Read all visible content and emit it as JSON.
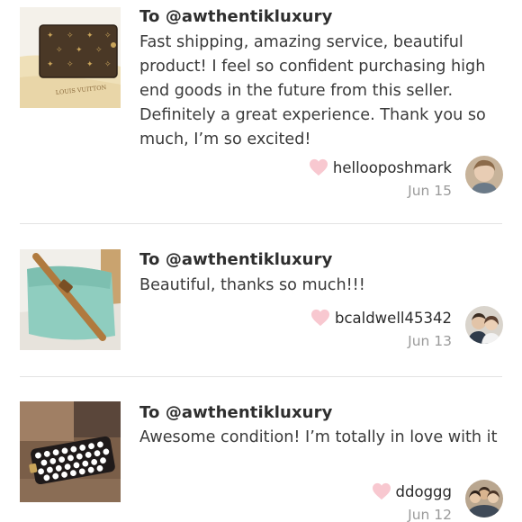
{
  "reviews": [
    {
      "to_line": "To @awthentikluxury",
      "text": "Fast shipping, amazing service, beautiful product! I feel so confident purchasing high end goods in the future from this seller. Definitely a great experience. Thank you so much, I’m so excited!",
      "username": "hellooposhmark",
      "date": "Jun 15",
      "photo_print": "LOUIS VUITTON",
      "heart_color": "#f8c8d0"
    },
    {
      "to_line": "To @awthentikluxury",
      "text": "Beautiful, thanks so much!!!",
      "username": "bcaldwell45342",
      "date": "Jun 13",
      "heart_color": "#f8c8d0"
    },
    {
      "to_line": "To @awthentikluxury",
      "text": "Awesome condition! I’m totally in love with it",
      "username": "ddoggg",
      "date": "Jun 12",
      "heart_color": "#f8c8d0"
    }
  ],
  "colors": {
    "text": "#3a3a3a",
    "date": "#9a9a9a",
    "divider": "#e3e3e3",
    "heart": "#f8c8d0"
  }
}
